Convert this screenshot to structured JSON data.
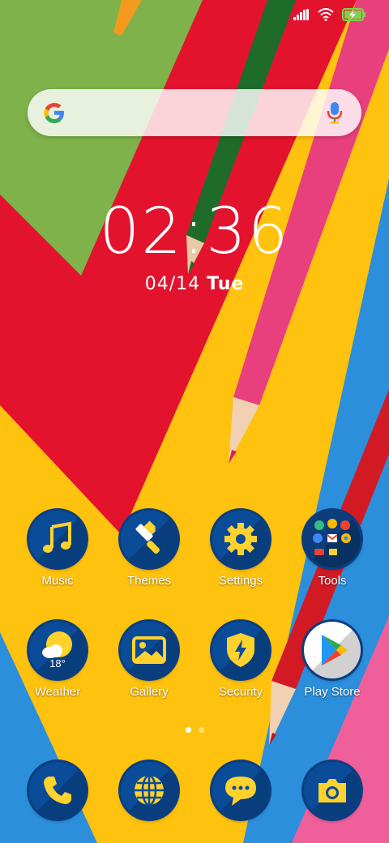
{
  "search": {
    "placeholder": ""
  },
  "clock": {
    "time": "02:36",
    "date": "04/14",
    "weekday": "Tue"
  },
  "apps": [
    {
      "label": "Music"
    },
    {
      "label": "Themes"
    },
    {
      "label": "Settings"
    },
    {
      "label": "Tools"
    },
    {
      "label": "Weather",
      "temperature": "18°"
    },
    {
      "label": "Gallery"
    },
    {
      "label": "Security"
    },
    {
      "label": "Play Store"
    }
  ],
  "dock": [
    {
      "name": "phone"
    },
    {
      "name": "browser"
    },
    {
      "name": "messages"
    },
    {
      "name": "camera"
    }
  ],
  "page_indicator": {
    "pages": 2,
    "current": 1
  },
  "colors": {
    "icon_bg": "#0b4c99",
    "icon_fg": "#ffd22e",
    "battery": "#7cd44a"
  }
}
